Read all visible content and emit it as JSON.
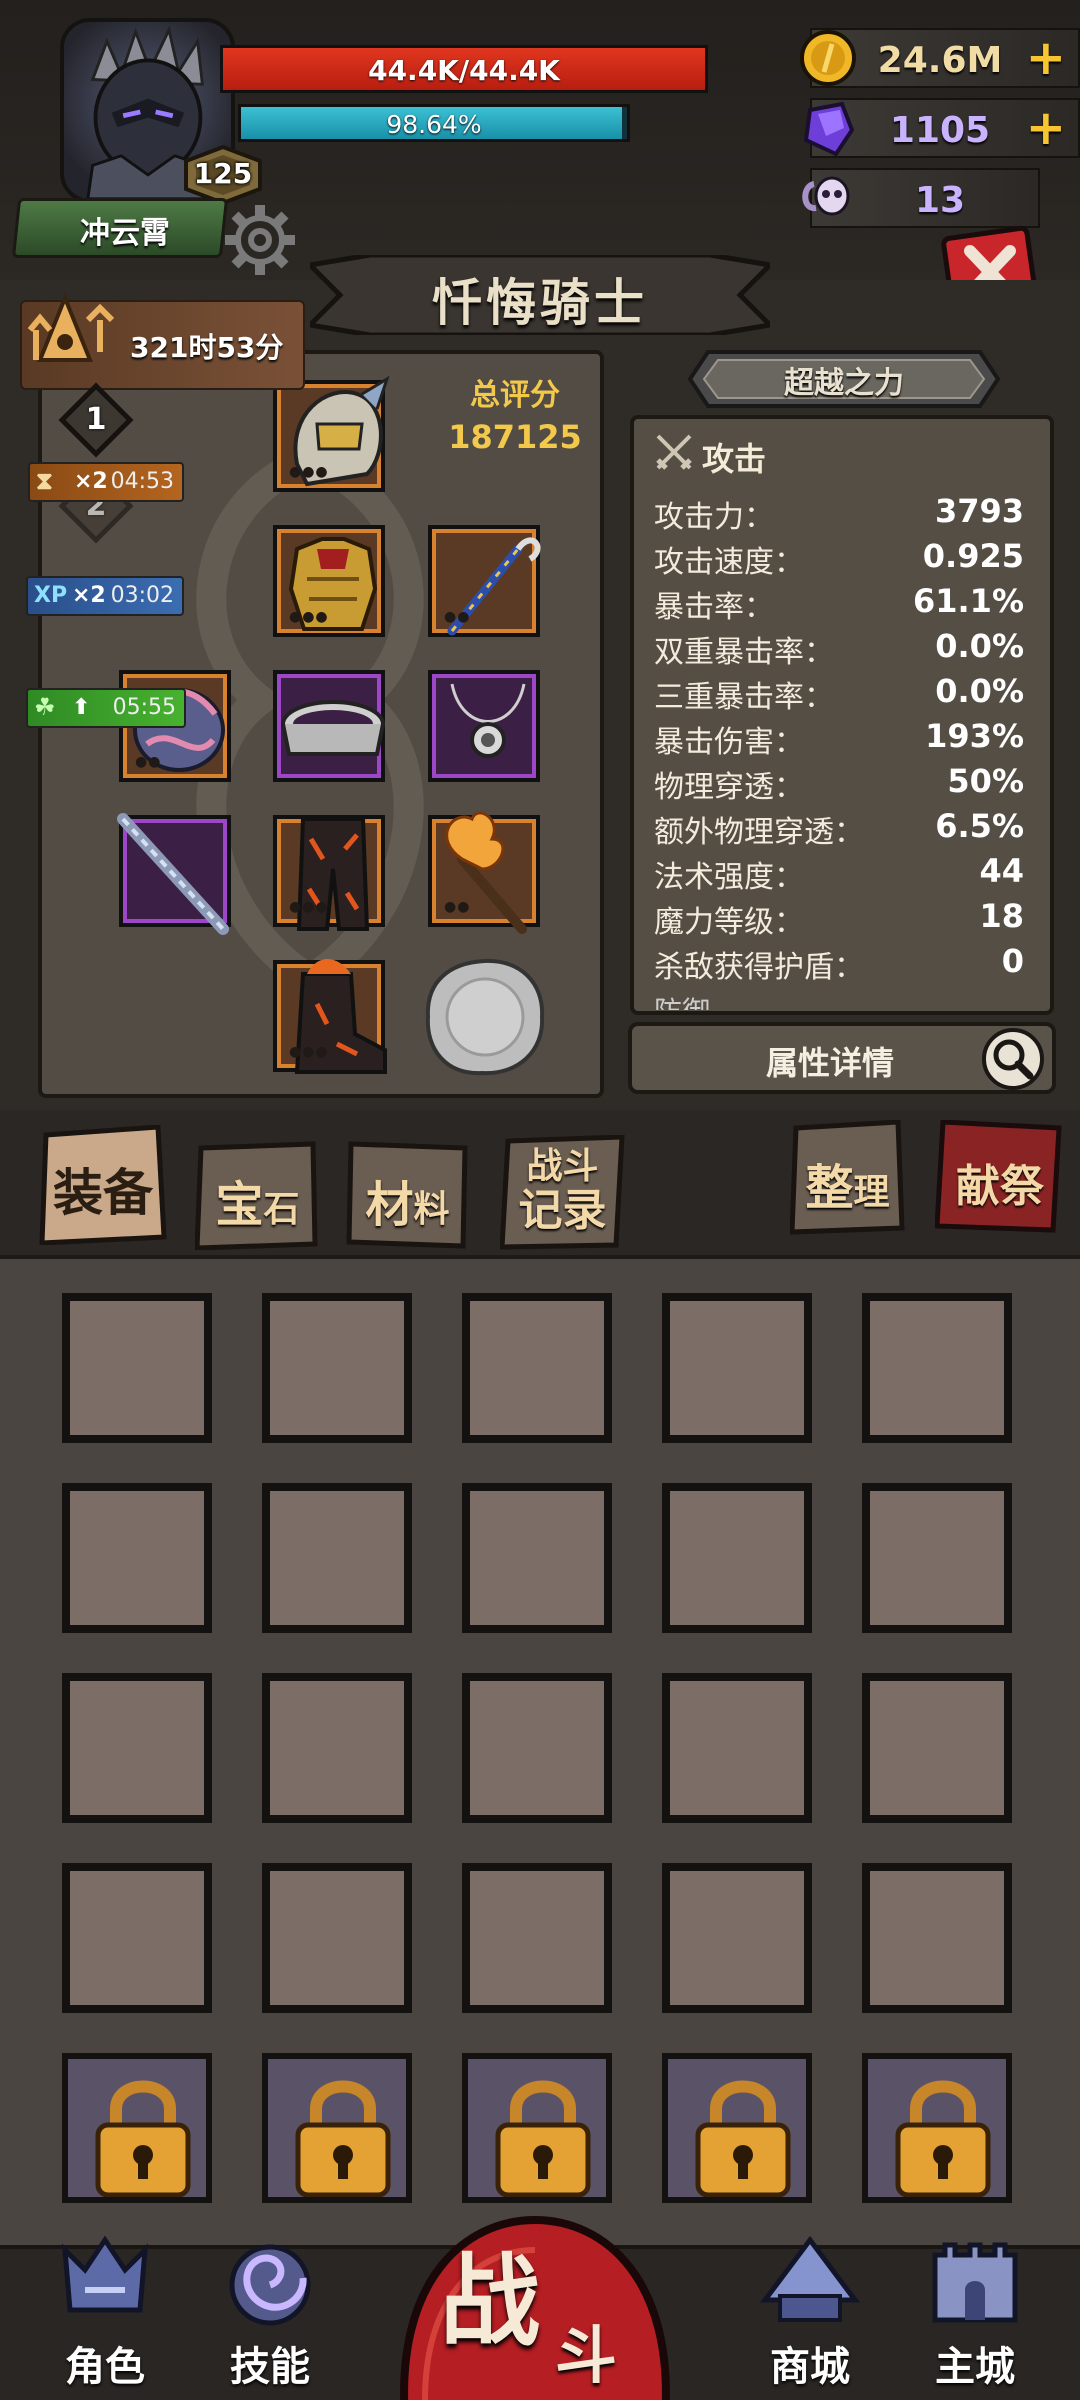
{
  "player": {
    "name": "冲云霄",
    "level": "125",
    "hp_text": "44.4K/44.4K",
    "hp_fraction": 1.0,
    "xp_text": "98.64%",
    "xp_fraction": 0.9864
  },
  "currencies": {
    "gold": "24.6M",
    "crystal": "1105",
    "skull": "13"
  },
  "character": {
    "class_title": "忏悔骑士",
    "score_label": "总评分",
    "score_value": "187125",
    "transcend_label": "超越之力",
    "detail_label": "属性详情"
  },
  "buffs": {
    "rank_timer": "321时53分",
    "rank_1": "1",
    "rank_2": "2",
    "hourglass": {
      "mult": "×2",
      "time": "04:53"
    },
    "xp": {
      "icon": "XP",
      "mult": "×2",
      "time": "03:02"
    },
    "clover": {
      "time": "05:55"
    }
  },
  "stats": {
    "section": "攻击",
    "next_section": "防御",
    "rows": [
      {
        "name": "攻击力：",
        "value": "3793"
      },
      {
        "name": "攻击速度：",
        "value": "0.925"
      },
      {
        "name": "暴击率：",
        "value": "61.1%"
      },
      {
        "name": "双重暴击率：",
        "value": "0.0%"
      },
      {
        "name": "三重暴击率：",
        "value": "0.0%"
      },
      {
        "name": "暴击伤害：",
        "value": "193%"
      },
      {
        "name": "物理穿透：",
        "value": "50%"
      },
      {
        "name": "额外物理穿透：",
        "value": "6.5%"
      },
      {
        "name": "法术强度：",
        "value": "44"
      },
      {
        "name": "魔力等级：",
        "value": "18"
      },
      {
        "name": "杀敌获得护盾：",
        "value": "0"
      }
    ]
  },
  "tabs": {
    "equipment": "装备",
    "gems_a": "宝",
    "gems_b": "石",
    "materials_a": "材",
    "materials_b": "料",
    "battle_log_a": "战斗",
    "battle_log_b": "记录",
    "sort_a": "整",
    "sort_b": "理",
    "sacrifice": "献祭"
  },
  "nav": {
    "character": "角色",
    "skills": "技能",
    "battle_a": "战",
    "battle_b": "斗",
    "shop": "商城",
    "main_city": "主城"
  },
  "icons": {
    "gold": "gold-coin-icon",
    "crystal": "purple-crystal-icon",
    "skull": "ram-skull-icon",
    "close": "close-x-icon",
    "search": "magnifier-icon",
    "attack": "crossed-swords-icon",
    "lock": "padlock-icon"
  },
  "colors": {
    "hp": "#d42a18",
    "xp": "#2bb0c6",
    "gold_text": "#f3c94c",
    "close": "#c8262b",
    "slot_orange": "#d8812f",
    "slot_purple": "#9c47c8"
  }
}
